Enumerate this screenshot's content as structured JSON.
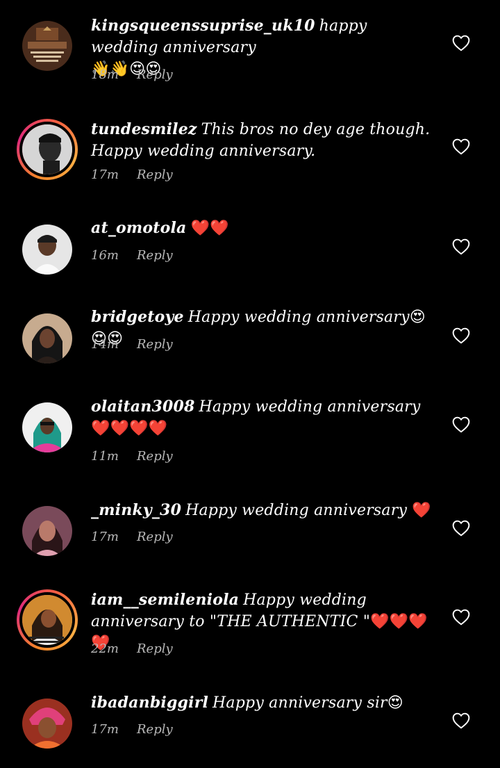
{
  "comments": [
    {
      "username": "kingsqueenssuprise_uk10",
      "text": "happy wedding anniversary",
      "emoji": "👋👋😍😍",
      "time": "18m",
      "reply": "Reply",
      "story": false,
      "avatar_color": "#5a3a28"
    },
    {
      "username": "tundesmilez",
      "text": "This bros no dey age though.  Happy wedding anniversary.",
      "emoji": "",
      "time": "17m",
      "reply": "Reply",
      "story": true,
      "avatar_color": "#cfcfcf"
    },
    {
      "username": "at_omotola",
      "text": "",
      "emoji": "❤️❤️",
      "time": "16m",
      "reply": "Reply",
      "story": false,
      "avatar_color": "#d9d9d9"
    },
    {
      "username": "bridgetoye",
      "text": "Happy wedding anniversary",
      "emoji": "😍😍😍",
      "time": "14m",
      "reply": "Reply",
      "story": false,
      "avatar_color": "#c8a98c"
    },
    {
      "username": "olaitan3008",
      "text": "Happy wedding anniversary",
      "emoji": "❤️❤️❤️❤️",
      "time": "11m",
      "reply": "Reply",
      "story": false,
      "avatar_color": "#e95ea4"
    },
    {
      "username": "_minky_30",
      "text": "Happy wedding anniversary ",
      "emoji": "❤️",
      "time": "17m",
      "reply": "Reply",
      "story": false,
      "avatar_color": "#b06a6c"
    },
    {
      "username": "iam__semileniola",
      "text": "Happy wedding anniversary to \"THE AUTHENTIC \"",
      "emoji": "❤️❤️❤️❤️",
      "time": "22m",
      "reply": "Reply",
      "story": true,
      "avatar_color": "#c58a3a"
    },
    {
      "username": "ibadanbiggirl",
      "text": "Happy anniversary sir",
      "emoji": "😍",
      "time": "17m",
      "reply": "Reply",
      "story": false,
      "avatar_color": "#d0453a"
    }
  ],
  "icons": {
    "like": "heart-outline-icon"
  },
  "colors": {
    "background": "#000000",
    "meta_text": "#b8b8b8",
    "heart": "#d90e21"
  }
}
